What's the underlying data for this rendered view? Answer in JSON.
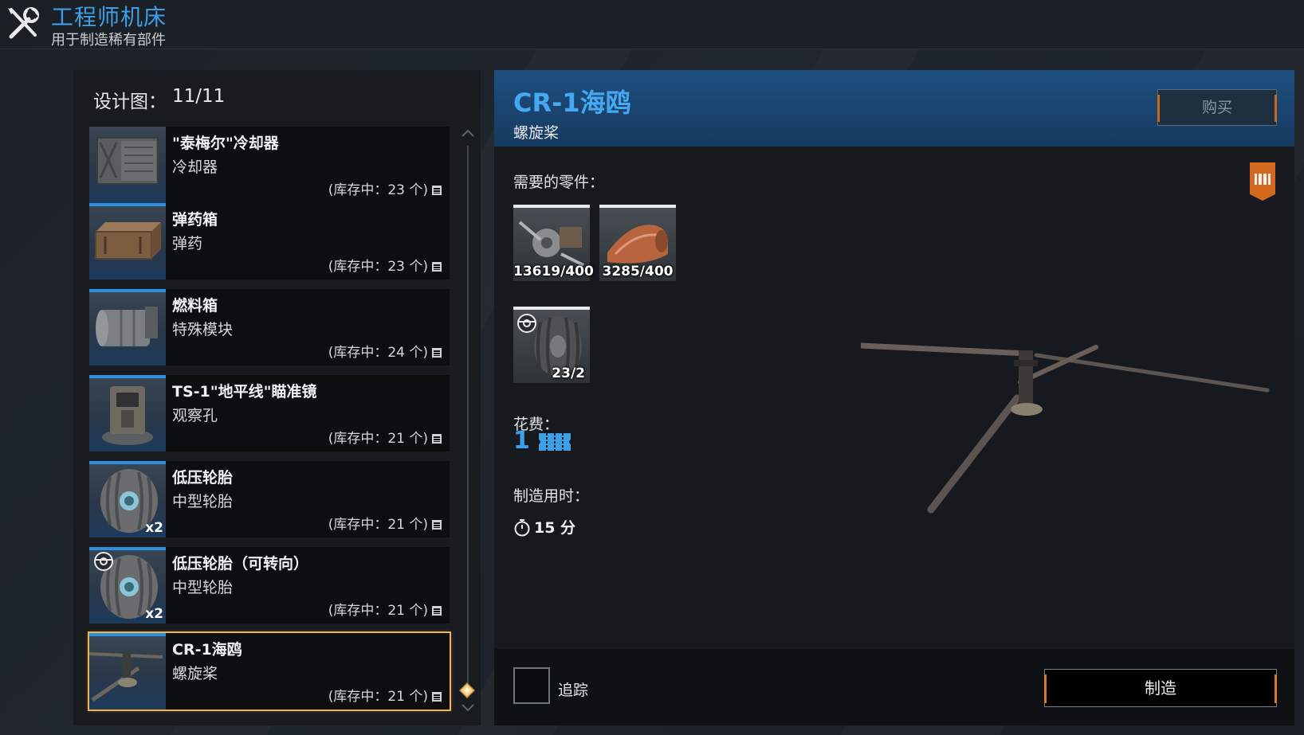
{
  "header": {
    "title": "工程师机床",
    "subtitle": "用于制造稀有部件",
    "icon": "wrench-screwdriver-icon"
  },
  "blueprints": {
    "label": "设计图：",
    "count": "11/11",
    "items": [
      {
        "name": "\"泰梅尔\"冷却器",
        "type": "冷却器",
        "stock": "(库存中：23 个)",
        "badge": "",
        "icon": "cooler-icon"
      },
      {
        "name": "弹药箱",
        "type": "弹药",
        "stock": "(库存中：23 个)",
        "badge": "",
        "icon": "ammo-box-icon"
      },
      {
        "name": "燃料箱",
        "type": "特殊模块",
        "stock": "(库存中：24 个)",
        "badge": "",
        "icon": "fuel-tank-icon"
      },
      {
        "name": "TS-1\"地平线\"瞄准镜",
        "type": "观察孔",
        "stock": "(库存中：21 个)",
        "badge": "",
        "icon": "periscope-icon"
      },
      {
        "name": "低压轮胎",
        "type": "中型轮胎",
        "stock": "(库存中：21 个)",
        "badge": "x2",
        "icon": "wheel-icon"
      },
      {
        "name": "低压轮胎（可转向）",
        "type": "中型轮胎",
        "stock": "(库存中：21 个)",
        "badge": "x2",
        "icon": "steerable-wheel-icon"
      },
      {
        "name": "CR-1海鸥",
        "type": "螺旋桨",
        "stock": "(库存中：21 个)",
        "badge": "",
        "icon": "propeller-icon"
      }
    ]
  },
  "detail": {
    "title": "CR-1海鸥",
    "type": "螺旋桨",
    "buy_label": "购买",
    "parts_label": "需要的零件：",
    "parts": [
      {
        "qty": "13619/400",
        "icon": "scrap-parts-icon"
      },
      {
        "qty": "3285/400",
        "icon": "copper-sheet-icon"
      },
      {
        "qty": "23/2",
        "icon": "steerable-wheel-icon"
      }
    ],
    "cost_label": "花费：",
    "cost_value": "1",
    "cost_icon": "coupon-icon",
    "time_label": "制造用时：",
    "time_value": "15 分",
    "track_label": "追踪",
    "craft_label": "制造"
  },
  "colors": {
    "accent_blue": "#3d9fe8",
    "selected_border": "#f0b44a",
    "button_edge": "#e07a22"
  }
}
